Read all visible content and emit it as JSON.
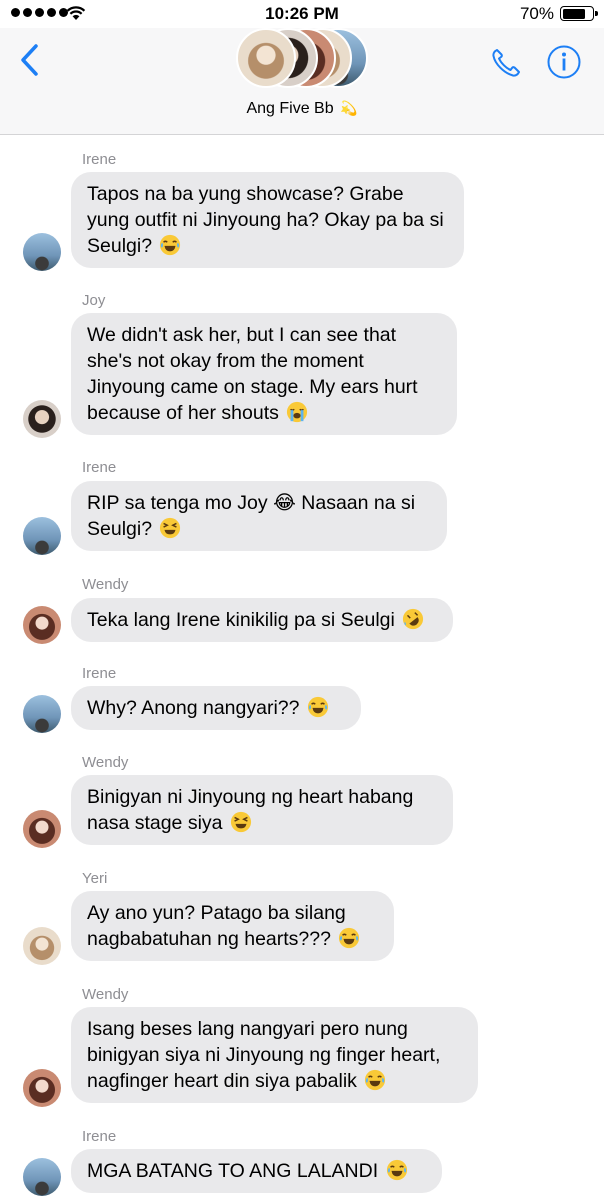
{
  "status_bar": {
    "time": "10:26 PM",
    "battery_percent": "70%",
    "battery_level": 0.7,
    "signal_bars": 5
  },
  "header": {
    "group_name": "Ang Five Bb",
    "group_emoji": "💫",
    "back_icon": "chevron-left-icon",
    "call_icon": "phone-icon",
    "info_icon": "info-icon",
    "accent_color": "#1d7ff5"
  },
  "messages": [
    {
      "sender": "Irene",
      "text": "Tapos na ba yung showcase? Grabe yung outfit ni Jinyoung ha? Okay pa ba si Seulgi?",
      "emoji": "face-with-tears-of-joy"
    },
    {
      "sender": "Joy",
      "text": "We didn't ask her, but I can see that she's not okay from the moment Jinyoung came on stage. My ears hurt because of her shouts",
      "emoji": "loudly-crying-face"
    },
    {
      "sender": "Irene",
      "text": "RIP sa tenga mo Joy 😂 Nasaan na si Seulgi?",
      "emoji": "squinting-face"
    },
    {
      "sender": "Wendy",
      "text": "Teka lang Irene kinikilig pa si Seulgi",
      "emoji": "rolling-on-floor-laughing"
    },
    {
      "sender": "Irene",
      "text": "Why? Anong nangyari??",
      "emoji": "face-with-tears-of-joy"
    },
    {
      "sender": "Wendy",
      "text": "Binigyan ni Jinyoung ng heart habang nasa stage siya",
      "emoji": "squinting-face"
    },
    {
      "sender": "Yeri",
      "text": "Ay ano yun? Patago ba silang nagbabatuhan ng hearts???",
      "emoji": "face-with-tears-of-joy"
    },
    {
      "sender": "Wendy",
      "text": "Isang beses lang nangyari pero nung binigyan siya ni Jinyoung ng finger heart, nagfinger heart din siya pabalik",
      "emoji": "face-with-tears-of-joy"
    },
    {
      "sender": "Irene",
      "text": "MGA BATANG TO ANG LALANDI",
      "emoji": "face-with-tears-of-joy"
    }
  ],
  "colors": {
    "bubble": "#e9e9eb",
    "sender_label": "#8e8e93",
    "header_bg": "#f7f7f8"
  }
}
